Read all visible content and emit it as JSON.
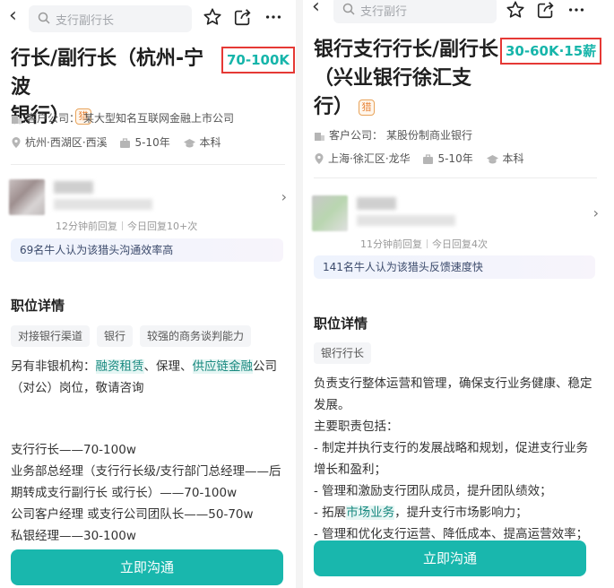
{
  "left": {
    "search_placeholder": "支行副行长",
    "title": "行长/副行长（杭州-宁波银行）",
    "title_line1": "行长/副行长（杭州-宁波",
    "title_line2": "银行）",
    "hunt_badge": "猎",
    "salary": "70-100K",
    "company_label": "客户公司：",
    "company": "某大型知名互联网金融上市公司",
    "location": "杭州·西湖区·西溪",
    "experience": "5-10年",
    "education": "本科",
    "reply_time": "12分钟前回复",
    "reply_today": "今日回复10+次",
    "banner": "69名牛人认为该猎头沟通效率高",
    "section_title": "职位详情",
    "tags": [
      "对接银行渠道",
      "银行",
      "较强的商务谈判能力"
    ],
    "desc_pre": "另有非银机构：",
    "desc_hl1": "融资租赁",
    "desc_mid": "、保理、",
    "desc_hl2": "供应链金融",
    "desc_post": "公司（对公）岗位，敬请咨询",
    "lines": [
      "支行行长——70-100w",
      "业务部总经理（支行行长级/支行部门总经理——后期转成支行副行长 或行长）——70-100w",
      "公司客户经理 或支行公司团队长——50-70w",
      "私银经理——30-100w"
    ],
    "cta": "立即沟通"
  },
  "right": {
    "search_placeholder": "支行副行",
    "title": "银行支行行长/副行长（兴业银行徐汇支行）",
    "title_line1": "银行支行行长/副行长",
    "title_line2": "（兴业银行徐汇支",
    "title_line3": "行）",
    "hunt_badge": "猎",
    "salary": "30-60K·15薪",
    "company_label": "客户公司：",
    "company": "某股份制商业银行",
    "location": "上海·徐汇区·龙华",
    "experience": "5-10年",
    "education": "本科",
    "reply_time": "11分钟前回复",
    "reply_today": "今日回复4次",
    "banner": "141名牛人认为该猎头反馈速度快",
    "section_title": "职位详情",
    "tags": [
      "银行行长"
    ],
    "intro": "负责支行整体运营和管理，确保支行业务健康、稳定发展。",
    "duties_title": "主要职责包括：",
    "duty1": "- 制定并执行支行的发展战略和规划，促进支行业务增长和盈利；",
    "duty2": "- 管理和激励支行团队成员，提升团队绩效；",
    "duty3_pre": "- 拓展",
    "duty3_hl": "市场业务",
    "duty3_post": "，提升支行市场影响力；",
    "duty4": "- 管理和优化支行运营、降低成本、提高运营效率；",
    "cta": "立即沟通"
  },
  "colors": {
    "accent": "#19b7ad",
    "salary_text": "#16b5aa",
    "highlight_box": "#e53935",
    "badge": "#e8863b"
  },
  "icons": [
    "back-icon",
    "search-icon",
    "star-icon",
    "share-icon",
    "more-icon",
    "building-icon",
    "location-icon",
    "briefcase-icon",
    "graduation-icon",
    "chevron-right-icon"
  ]
}
